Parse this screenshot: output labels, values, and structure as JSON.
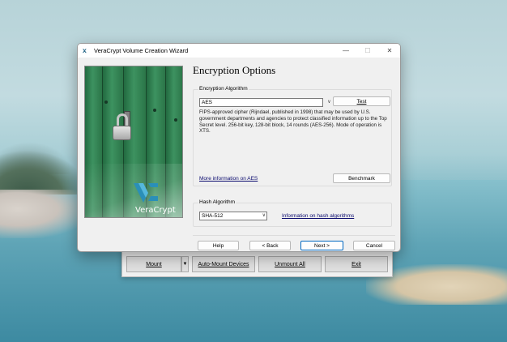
{
  "main_window": {
    "mount_label": "Mount",
    "arrow_icon": "dropdown-arrow-icon",
    "auto_mount_label": "Auto-Mount Devices",
    "unmount_all_label": "Unmount All",
    "exit_label": "Exit"
  },
  "dialog": {
    "title": "VeraCrypt Volume Creation Wizard",
    "page_title": "Encryption Options",
    "banner_brand": "VeraCrypt",
    "encryption": {
      "group_label": "Encryption Algorithm",
      "selected": "AES",
      "test_label": "Test",
      "description": "FIPS-approved cipher (Rijndael, published in 1998) that may be used by U.S. government departments and agencies to protect classified information up to the Top Secret level. 256-bit key, 128-bit block, 14 rounds (AES-256). Mode of operation is XTS.",
      "more_info_link": "More information on AES",
      "benchmark_label": "Benchmark"
    },
    "hash": {
      "group_label": "Hash Algorithm",
      "selected": "SHA-512",
      "info_link": "Information on hash algorithms"
    },
    "buttons": {
      "help": "Help",
      "back": "< Back",
      "next": "Next >",
      "cancel": "Cancel"
    }
  },
  "colors": {
    "accent": "#0067c0",
    "link": "#0a0a6e",
    "dialog_bg": "#f0f0f0"
  }
}
